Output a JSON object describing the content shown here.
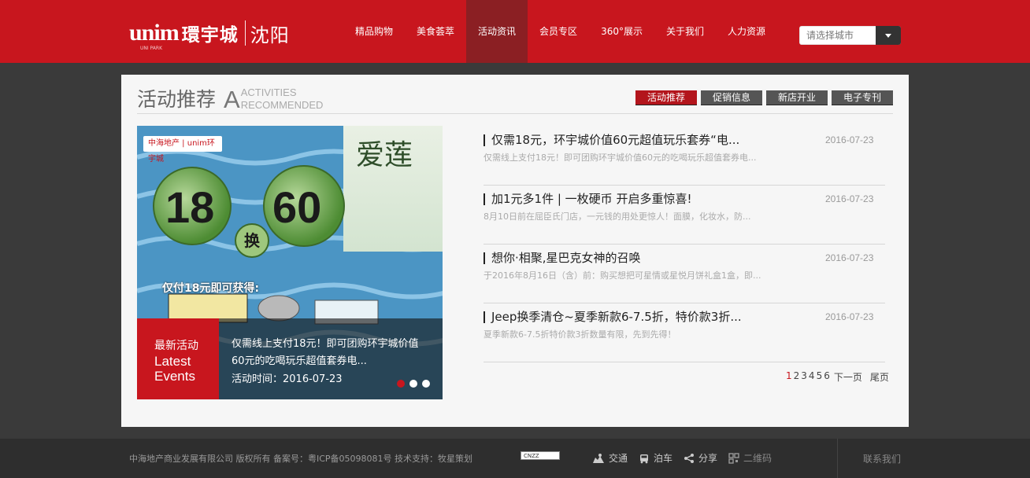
{
  "header": {
    "logo_en": "unim",
    "logo_en_sub": "UNI PARK",
    "logo_cn": "環宇城",
    "city": "沈阳",
    "nav": [
      {
        "label": "精品购物",
        "active": false
      },
      {
        "label": "美食荟萃",
        "active": false
      },
      {
        "label": "活动资讯",
        "active": true
      },
      {
        "label": "会员专区",
        "active": false
      },
      {
        "label": "360°展示",
        "active": false
      },
      {
        "label": "关于我们",
        "active": false
      },
      {
        "label": "人力资源",
        "active": false
      }
    ],
    "city_select_placeholder": "请选择城市"
  },
  "section": {
    "title_cn": "活动推荐",
    "title_a": "A",
    "title_en_1": "ACTIVITIES",
    "title_en_2": "RECOMMENDED",
    "tabs": [
      {
        "label": "活动推荐",
        "active": true
      },
      {
        "label": "促销信息",
        "active": false
      },
      {
        "label": "新店开业",
        "active": false
      },
      {
        "label": "电子专刊",
        "active": false
      }
    ]
  },
  "banner": {
    "brand_text": "中海地产 | unim环宇城",
    "lotus_text": "爱莲",
    "num_left": "18",
    "num_right": "60",
    "huan": "换",
    "pay_text": "仅付18元即可获得:",
    "latest_cn": "最新活动",
    "latest_en_1": "Latest",
    "latest_en_2": "Events",
    "caption_text": "仅需线上支付18元！即可团购环宇城价值60元的吃喝玩乐超值套券电...",
    "caption_date": "活动时间：2016-07-23",
    "slides": 3,
    "active_slide": 0
  },
  "news": [
    {
      "title": "仅需18元，环宇城价值60元超值玩乐套券“电...",
      "date": "2016-07-23",
      "summary": "仅需线上支付18元！即可团购环宇城价值60元的吃喝玩乐超值套券电..."
    },
    {
      "title": "加1元多1件 | 一枚硬币 开启多重惊喜!",
      "date": "2016-07-23",
      "summary": "8月10日前在屈臣氏门店，一元钱的用处更惊人！面膜，化妆水，防..."
    },
    {
      "title": "想你·相聚,星巴克女神的召唤",
      "date": "2016-07-23",
      "summary": "于2016年8月16日（含）前：购买想把可星情或星悦月饼礼盒1盒，即..."
    },
    {
      "title": "Jeep换季清仓~夏季新款6-7.5折，特价款3折...",
      "date": "2016-07-23",
      "summary": "夏季新款6-7.5折特价款3折数量有限，先到先得！"
    }
  ],
  "pager": {
    "pages": [
      "1",
      "2",
      "3",
      "4",
      "5",
      "6"
    ],
    "current": "1",
    "next": "下一页",
    "last": "尾页"
  },
  "footer": {
    "copyright": "中海地产商业发展有限公司 版权所有   备案号：粤ICP备05098081号   技术支持：牧星策划",
    "cnzz": "CNZZ",
    "links": [
      {
        "label": "交通",
        "icon": "map-icon"
      },
      {
        "label": "泊车",
        "icon": "car-icon"
      },
      {
        "label": "分享",
        "icon": "share-icon"
      },
      {
        "label": "二维码",
        "icon": "qrcode-icon"
      }
    ],
    "contact": "联系我们"
  }
}
